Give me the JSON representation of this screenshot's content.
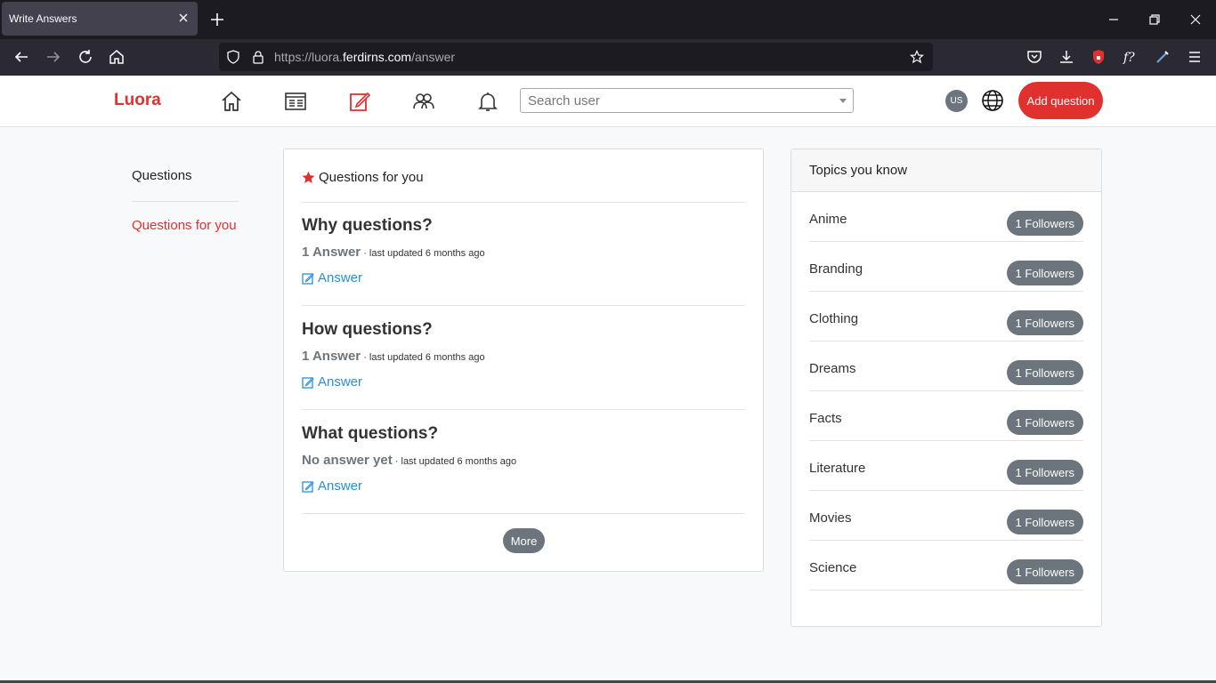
{
  "browser": {
    "tab_title": "Write Answers",
    "url_prefix": "https://luora.",
    "url_domain": "ferdirns.com",
    "url_path": "/answer"
  },
  "app": {
    "brand": "Luora",
    "search_placeholder": "Search user",
    "avatar_initials": "US",
    "add_question_label": "Add question",
    "accent_color": "#e0312f"
  },
  "sidebar": {
    "items": [
      {
        "label": "Questions"
      },
      {
        "label": "Questions for you"
      }
    ]
  },
  "main": {
    "heading": "Questions for you",
    "questions": [
      {
        "title": "Why questions?",
        "answers": "1 Answer",
        "updated": "· last updated 6 months ago",
        "action": "Answer"
      },
      {
        "title": "How questions?",
        "answers": "1 Answer",
        "updated": "· last updated 6 months ago",
        "action": "Answer"
      },
      {
        "title": "What questions?",
        "answers": "No answer yet",
        "updated": "· last updated 6 months ago",
        "action": "Answer"
      }
    ],
    "more_label": "More"
  },
  "topics": {
    "heading": "Topics you know",
    "items": [
      {
        "name": "Anime",
        "followers": "1 Followers"
      },
      {
        "name": "Branding",
        "followers": "1 Followers"
      },
      {
        "name": "Clothing",
        "followers": "1 Followers"
      },
      {
        "name": "Dreams",
        "followers": "1 Followers"
      },
      {
        "name": "Facts",
        "followers": "1 Followers"
      },
      {
        "name": "Literature",
        "followers": "1 Followers"
      },
      {
        "name": "Movies",
        "followers": "1 Followers"
      },
      {
        "name": "Science",
        "followers": "1 Followers"
      }
    ]
  }
}
